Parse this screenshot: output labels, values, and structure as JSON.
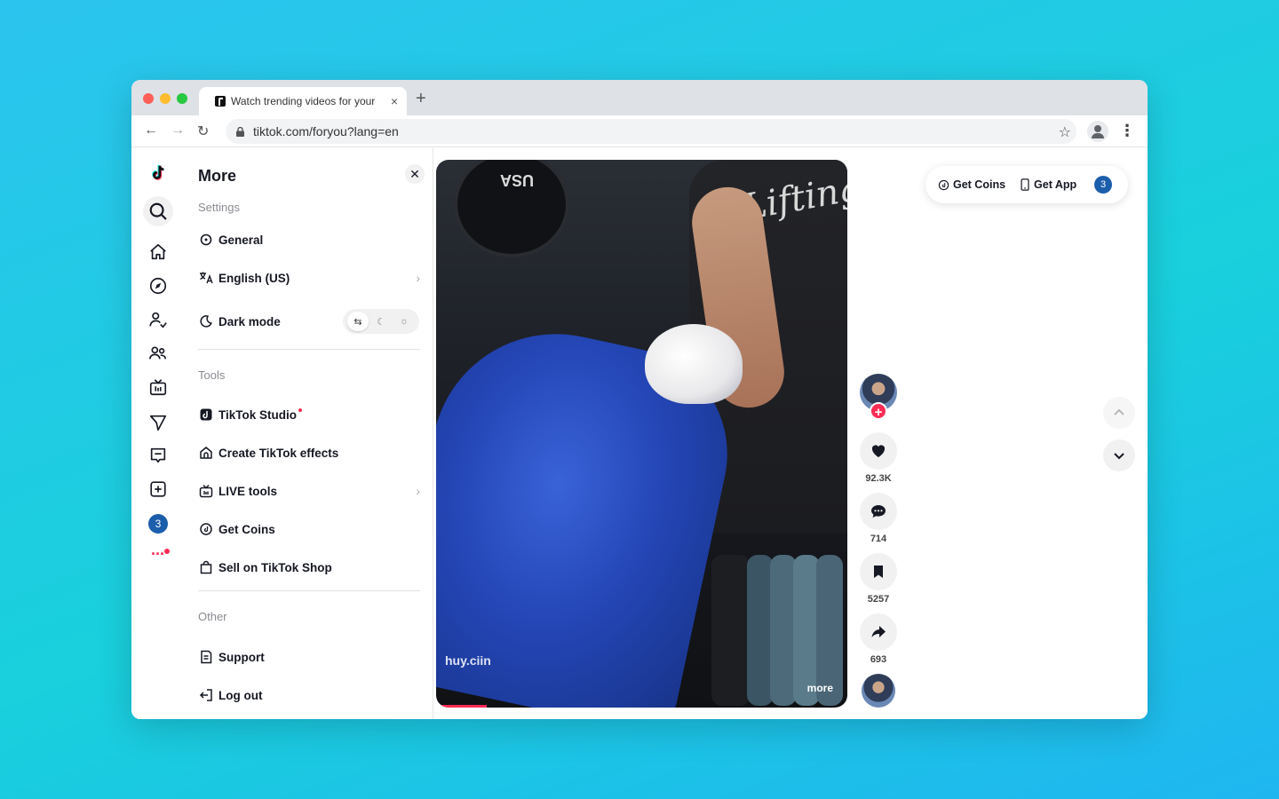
{
  "browser": {
    "tab_title": "Watch trending videos for your",
    "tab_close": "×",
    "new_tab": "+",
    "url": "tiktok.com/foryou?lang=en"
  },
  "rail": {
    "notification_count": "3"
  },
  "panel": {
    "title": "More",
    "settings_header": "Settings",
    "general": "General",
    "language": "English (US)",
    "dark_mode": "Dark mode",
    "tools_header": "Tools",
    "studio": "TikTok Studio",
    "effects": "Create TikTok effects",
    "live_tools": "LIVE tools",
    "get_coins": "Get Coins",
    "shop": "Sell on TikTok Shop",
    "other_header": "Other",
    "support": "Support",
    "logout": "Log out"
  },
  "video": {
    "watermark": "huy.ciin",
    "more": "more",
    "progress": 0.11
  },
  "actions": {
    "likes": "92.3K",
    "comments": "714",
    "saves": "5257",
    "shares": "693"
  },
  "topbar": {
    "get_coins": "Get Coins",
    "get_app": "Get App",
    "inbox_count": "3"
  },
  "colors": {
    "accent": "#fe2c55",
    "badge": "#1b5eab"
  }
}
